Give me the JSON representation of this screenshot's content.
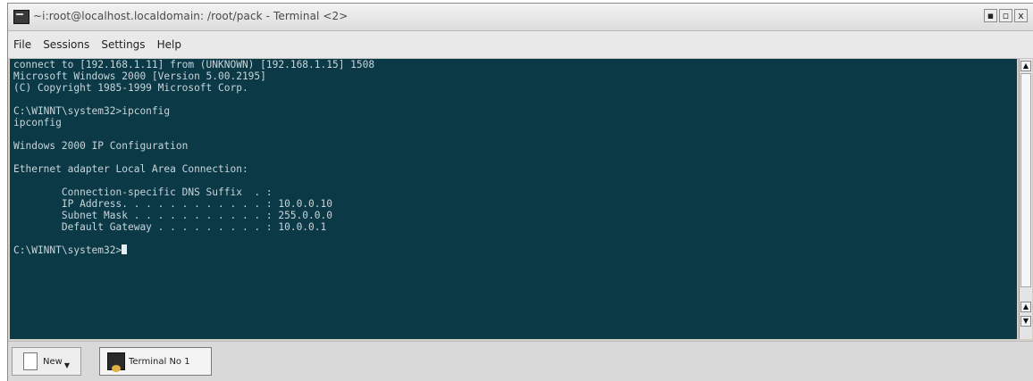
{
  "window": {
    "title": "~i:root@localhost.localdomain: /root/pack - Terminal <2>",
    "wm_buttons": [
      "▪",
      "▫",
      "x"
    ]
  },
  "menubar": {
    "items": [
      "File",
      "Sessions",
      "Settings",
      "Help"
    ]
  },
  "terminal": {
    "lines": [
      "connect to [192.168.1.11] from (UNKNOWN) [192.168.1.15] 1508",
      "Microsoft Windows 2000 [Version 5.00.2195]",
      "(C) Copyright 1985-1999 Microsoft Corp.",
      "",
      "C:\\WINNT\\system32>ipconfig",
      "ipconfig",
      "",
      "Windows 2000 IP Configuration",
      "",
      "Ethernet adapter Local Area Connection:",
      "",
      "        Connection-specific DNS Suffix  . :",
      "        IP Address. . . . . . . . . . . . : 10.0.0.10",
      "        Subnet Mask . . . . . . . . . . . : 255.0.0.0",
      "        Default Gateway . . . . . . . . . : 10.0.0.1",
      "",
      "C:\\WINNT\\system32>"
    ],
    "background": "#0b3946",
    "foreground": "#c8d5da"
  },
  "scrollbar": {
    "up_icon": "▲",
    "down_icon": "▼"
  },
  "taskbar": {
    "new_label": "New",
    "new_icon": "document-icon",
    "session_label": "Terminal No 1",
    "session_icon": "terminal-icon"
  }
}
